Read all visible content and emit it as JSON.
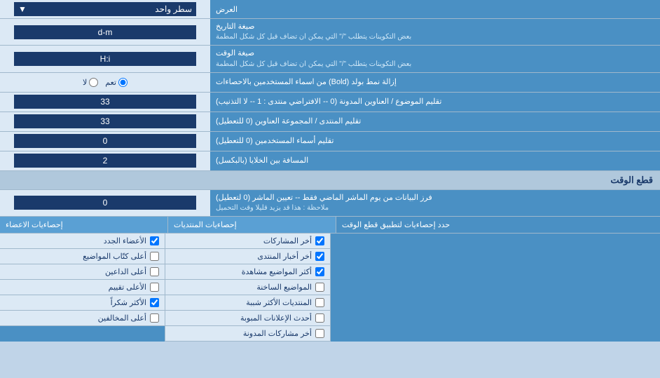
{
  "header": {
    "label": "العرض",
    "dropdown_label": "سطر واحد"
  },
  "rows": [
    {
      "id": "date_format",
      "label": "صيغة التاريخ",
      "sublabel": "بعض التكوينات يتطلب \"/\" التي يمكن ان تضاف قبل كل شكل المطمة",
      "value": "d-m",
      "type": "input"
    },
    {
      "id": "time_format",
      "label": "صيغة الوقت",
      "sublabel": "بعض التكوينات يتطلب \"/\" التي يمكن ان تضاف قبل كل شكل المطمة",
      "value": "H:i",
      "type": "input"
    },
    {
      "id": "bold_remove",
      "label": "إزالة نمط بولد (Bold) من اسماء المستخدمين بالاحصاءات",
      "type": "radio",
      "options": [
        {
          "value": "yes",
          "label": "تعم",
          "checked": true
        },
        {
          "value": "no",
          "label": "لا",
          "checked": false
        }
      ]
    },
    {
      "id": "topic_titles",
      "label": "تقليم الموضوع / العناوين المدونة (0 -- الافتراضي منتدى : 1 -- لا التذنيب)",
      "value": "33",
      "type": "input"
    },
    {
      "id": "forum_titles",
      "label": "تقليم المنتدى / المجموعة العناوين (0 للتعطيل)",
      "value": "33",
      "type": "input"
    },
    {
      "id": "usernames",
      "label": "تقليم أسماء المستخدمين (0 للتعطيل)",
      "value": "0",
      "type": "input"
    },
    {
      "id": "cell_spacing",
      "label": "المسافة بين الخلايا (بالبكسل)",
      "value": "2",
      "type": "input"
    }
  ],
  "cutoff_section": {
    "header": "قطع الوقت",
    "row": {
      "label": "فرز البيانات من يوم الماشر الماضي فقط -- تعيين الماشر (0 لتعطيل)\nملاحظة : هذا قد يزيد قليلا وقت التحميل",
      "value": "0",
      "type": "input"
    }
  },
  "stats_section": {
    "apply_label": "حدد إحصاءيات لتطبيق قطع الوقت",
    "col1_header": "إحصاءيات المنتديات",
    "col2_header": "إحصاءيات الاعضاء",
    "col1_items": [
      {
        "label": "أخر المشاركات",
        "checked": true
      },
      {
        "label": "أخر أخبار المنتدى",
        "checked": true
      },
      {
        "label": "أكثر المواضيع مشاهدة",
        "checked": true
      },
      {
        "label": "المواضيع الساخنة",
        "checked": false
      },
      {
        "label": "المنتديات الأكثر شببة",
        "checked": false
      },
      {
        "label": "أحدث الإعلانات المبوبة",
        "checked": false
      },
      {
        "label": "أخر مشاركات المدونة",
        "checked": false
      }
    ],
    "col2_items": [
      {
        "label": "الأعضاء الجدد",
        "checked": true
      },
      {
        "label": "أعلى كتّاب المواضيع",
        "checked": false
      },
      {
        "label": "أعلى الداعين",
        "checked": false
      },
      {
        "label": "الأعلى تقييم",
        "checked": false
      },
      {
        "label": "الأكثر شكراً",
        "checked": true
      },
      {
        "label": "أعلى المخالفين",
        "checked": false
      }
    ]
  }
}
